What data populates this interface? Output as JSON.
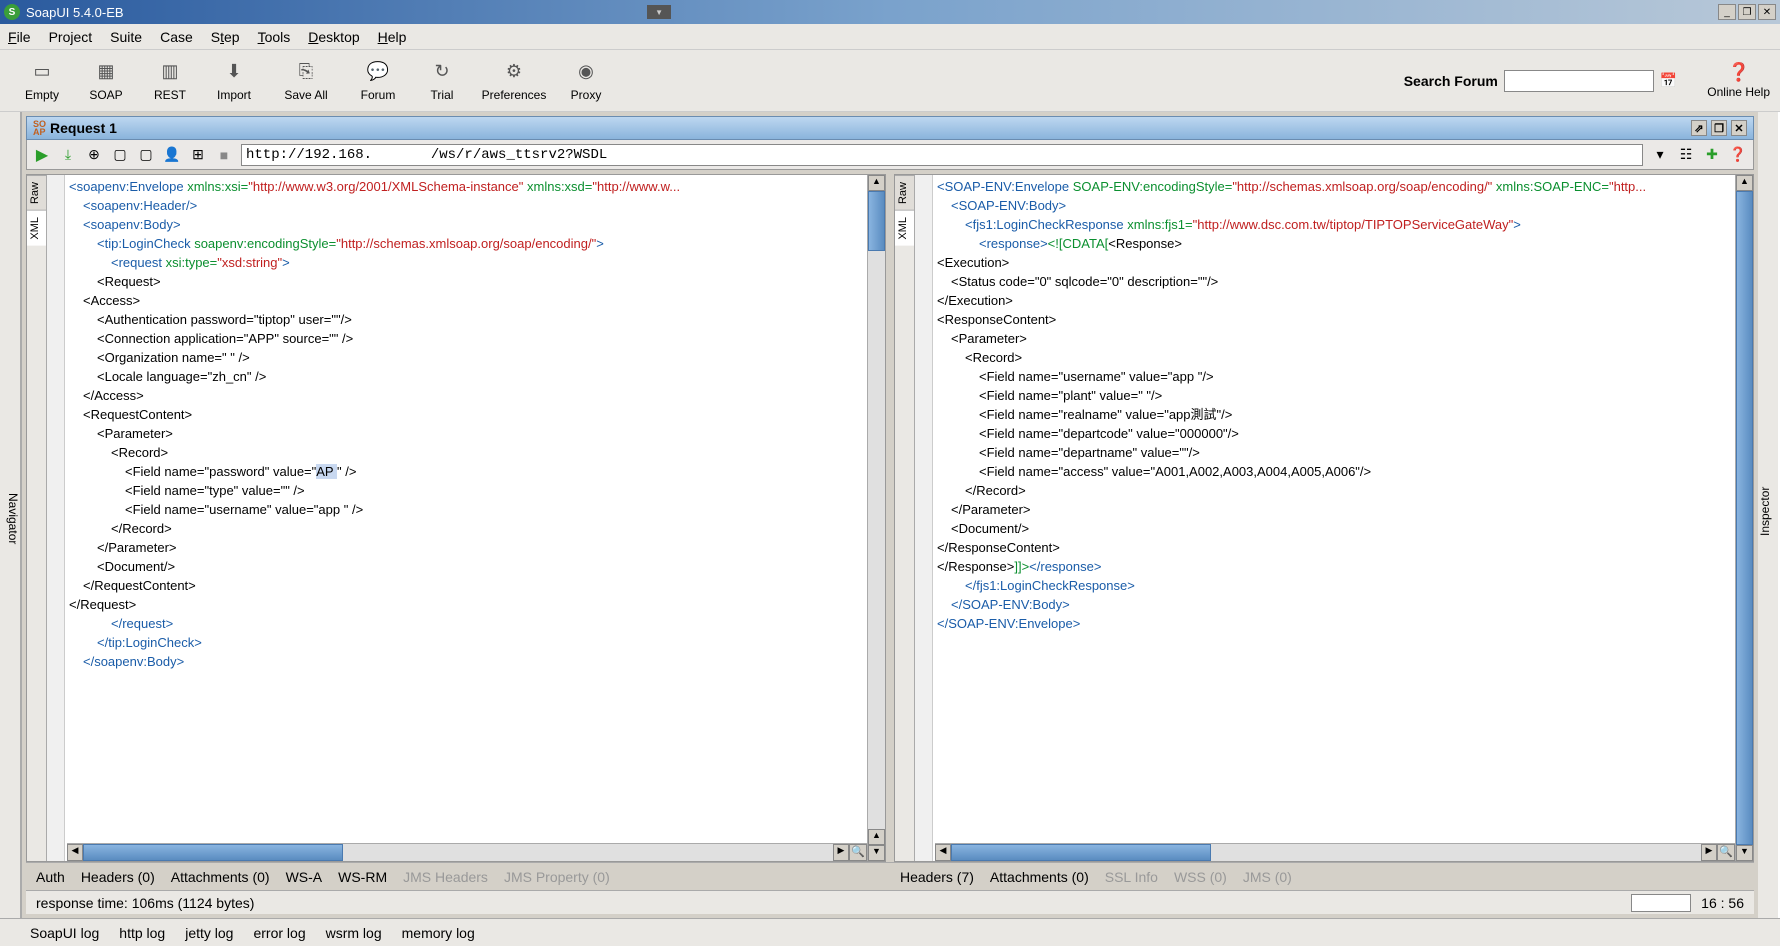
{
  "app": {
    "title": "SoapUI 5.4.0-EB"
  },
  "menubar": [
    "File",
    "Project",
    "Suite",
    "Case",
    "Step",
    "Tools",
    "Desktop",
    "Help"
  ],
  "toolbar": {
    "items": [
      "Empty",
      "SOAP",
      "REST",
      "Import",
      "Save All",
      "Forum",
      "Trial",
      "Preferences",
      "Proxy"
    ],
    "search_label": "Search Forum",
    "search_value": "",
    "online_help": "Online Help"
  },
  "sidebar_left": "Navigator",
  "sidebar_right": "Inspector",
  "request_tab": {
    "badge": "SO\nAP",
    "label": "Request 1"
  },
  "url": "http://192.168.       /ws/r/aws_ttsrv2?WSDL",
  "panel_vtabs": [
    "Raw",
    "XML"
  ],
  "request_xml": {
    "lines": [
      {
        "i": 0,
        "parts": [
          {
            "t": "tag",
            "s": "<soapenv:Envelope "
          },
          {
            "t": "attr",
            "s": "xmlns:xsi="
          },
          {
            "t": "val",
            "s": "\"http://www.w3.org/2001/XMLSchema-instance\" "
          },
          {
            "t": "attr",
            "s": "xmlns:xsd="
          },
          {
            "t": "val",
            "s": "\"http://www.w..."
          }
        ]
      },
      {
        "i": 1,
        "parts": [
          {
            "t": "tag",
            "s": "<soapenv:Header/>"
          }
        ]
      },
      {
        "i": 1,
        "parts": [
          {
            "t": "tag",
            "s": "<soapenv:Body>"
          }
        ]
      },
      {
        "i": 2,
        "parts": [
          {
            "t": "tag",
            "s": "<tip:LoginCheck "
          },
          {
            "t": "attr",
            "s": "soapenv:encodingStyle="
          },
          {
            "t": "val",
            "s": "\"http://schemas.xmlsoap.org/soap/encoding/\""
          },
          {
            "t": "tag",
            "s": ">"
          }
        ]
      },
      {
        "i": 3,
        "parts": [
          {
            "t": "tag",
            "s": "<request "
          },
          {
            "t": "attr",
            "s": "xsi:type="
          },
          {
            "t": "val",
            "s": "\"xsd:string\""
          },
          {
            "t": "tag",
            "s": ">"
          }
        ]
      },
      {
        "i": 2,
        "parts": [
          {
            "t": "text",
            "s": "&lt;Request>"
          }
        ]
      },
      {
        "i": 1,
        "parts": [
          {
            "t": "text",
            "s": "&lt;Access>"
          }
        ]
      },
      {
        "i": 2,
        "parts": [
          {
            "t": "text",
            "s": "&lt;Authentication password=\"tiptop\" user=\"\"/>"
          }
        ]
      },
      {
        "i": 2,
        "parts": [
          {
            "t": "text",
            "s": "&lt;Connection application=\"APP\" source=\"\" />"
          }
        ]
      },
      {
        "i": 2,
        "parts": [
          {
            "t": "text",
            "s": "&lt;Organization name=\"    \" />"
          }
        ]
      },
      {
        "i": 2,
        "parts": [
          {
            "t": "text",
            "s": "&lt;Locale language=\"zh_cn\" />"
          }
        ]
      },
      {
        "i": 1,
        "parts": [
          {
            "t": "text",
            "s": "&lt;/Access>"
          }
        ]
      },
      {
        "i": 1,
        "parts": [
          {
            "t": "text",
            "s": "&lt;RequestContent>"
          }
        ]
      },
      {
        "i": 2,
        "parts": [
          {
            "t": "text",
            "s": "&lt;Parameter>"
          }
        ]
      },
      {
        "i": 3,
        "parts": [
          {
            "t": "text",
            "s": "&lt;Record>"
          }
        ]
      },
      {
        "i": 4,
        "parts": [
          {
            "t": "text",
            "s": "&lt;Field name=\"password\" value=\""
          },
          {
            "t": "sel",
            "s": "AP   "
          },
          {
            "t": "caret",
            "s": " "
          },
          {
            "t": "text",
            "s": "\" />"
          }
        ]
      },
      {
        "i": 4,
        "parts": [
          {
            "t": "text",
            "s": "&lt;Field name=\"type\" value=\"\" />"
          }
        ]
      },
      {
        "i": 4,
        "parts": [
          {
            "t": "text",
            "s": "&lt;Field name=\"username\" value=\"app   \" />"
          }
        ]
      },
      {
        "i": 3,
        "parts": [
          {
            "t": "text",
            "s": "&lt;/Record>"
          }
        ]
      },
      {
        "i": 2,
        "parts": [
          {
            "t": "text",
            "s": "&lt;/Parameter>"
          }
        ]
      },
      {
        "i": 2,
        "parts": [
          {
            "t": "text",
            "s": "&lt;Document/>"
          }
        ]
      },
      {
        "i": 1,
        "parts": [
          {
            "t": "text",
            "s": "&lt;/RequestContent>"
          }
        ]
      },
      {
        "i": 0,
        "parts": [
          {
            "t": "text",
            "s": "&lt;/Request>"
          }
        ]
      },
      {
        "i": 3,
        "parts": [
          {
            "t": "tag",
            "s": "</request>"
          }
        ]
      },
      {
        "i": 2,
        "parts": [
          {
            "t": "tag",
            "s": "</tip:LoginCheck>"
          }
        ]
      },
      {
        "i": 1,
        "parts": [
          {
            "t": "tag",
            "s": "</soapenv:Body>"
          }
        ]
      }
    ]
  },
  "response_xml": {
    "lines": [
      {
        "i": 0,
        "parts": [
          {
            "t": "tag",
            "s": "<SOAP-ENV:Envelope "
          },
          {
            "t": "attr",
            "s": "SOAP-ENV:encodingStyle="
          },
          {
            "t": "val",
            "s": "\"http://schemas.xmlsoap.org/soap/encoding/\" "
          },
          {
            "t": "attr",
            "s": "xmlns:SOAP-ENC="
          },
          {
            "t": "val",
            "s": "\"http..."
          }
        ]
      },
      {
        "i": 1,
        "parts": [
          {
            "t": "tag",
            "s": "<SOAP-ENV:Body>"
          }
        ]
      },
      {
        "i": 2,
        "parts": [
          {
            "t": "tag",
            "s": "<fjs1:LoginCheckResponse "
          },
          {
            "t": "attr",
            "s": "xmlns:fjs1="
          },
          {
            "t": "val",
            "s": "\"http://www.dsc.com.tw/tiptop/TIPTOPServiceGateWay\""
          },
          {
            "t": "tag",
            "s": ">"
          }
        ]
      },
      {
        "i": 3,
        "parts": [
          {
            "t": "tag",
            "s": "<response>"
          },
          {
            "t": "cdata",
            "s": "<![CDATA["
          },
          {
            "t": "text",
            "s": "<Response>"
          }
        ]
      },
      {
        "i": 0,
        "parts": [
          {
            "t": "text",
            "s": "<Execution>"
          }
        ]
      },
      {
        "i": 1,
        "parts": [
          {
            "t": "text",
            "s": "<Status code=\"0\" sqlcode=\"0\" description=\"\"/>"
          }
        ]
      },
      {
        "i": 0,
        "parts": [
          {
            "t": "text",
            "s": "</Execution>"
          }
        ]
      },
      {
        "i": 0,
        "parts": [
          {
            "t": "text",
            "s": "<ResponseContent>"
          }
        ]
      },
      {
        "i": 1,
        "parts": [
          {
            "t": "text",
            "s": "<Parameter>"
          }
        ]
      },
      {
        "i": 2,
        "parts": [
          {
            "t": "text",
            "s": "<Record>"
          }
        ]
      },
      {
        "i": 3,
        "parts": [
          {
            "t": "text",
            "s": "<Field name=\"username\" value=\"app   \"/>"
          }
        ]
      },
      {
        "i": 3,
        "parts": [
          {
            "t": "text",
            "s": "<Field name=\"plant\" value=\"    \"/>"
          }
        ]
      },
      {
        "i": 3,
        "parts": [
          {
            "t": "text",
            "s": "<Field name=\"realname\" value=\"app測試\"/>"
          }
        ]
      },
      {
        "i": 3,
        "parts": [
          {
            "t": "text",
            "s": "<Field name=\"departcode\" value=\"000000\"/>"
          }
        ]
      },
      {
        "i": 3,
        "parts": [
          {
            "t": "text",
            "s": "<Field name=\"departname\" value=\"\"/>"
          }
        ]
      },
      {
        "i": 3,
        "parts": [
          {
            "t": "text",
            "s": "<Field name=\"access\" value=\"A001,A002,A003,A004,A005,A006\"/>"
          }
        ]
      },
      {
        "i": 2,
        "parts": [
          {
            "t": "text",
            "s": "</Record>"
          }
        ]
      },
      {
        "i": 1,
        "parts": [
          {
            "t": "text",
            "s": "</Parameter>"
          }
        ]
      },
      {
        "i": 1,
        "parts": [
          {
            "t": "text",
            "s": "<Document/>"
          }
        ]
      },
      {
        "i": 0,
        "parts": [
          {
            "t": "text",
            "s": "</ResponseContent>"
          }
        ]
      },
      {
        "i": 0,
        "parts": [
          {
            "t": "text",
            "s": "</Response>"
          },
          {
            "t": "cdata",
            "s": "]]>"
          },
          {
            "t": "tag",
            "s": "</response>"
          }
        ]
      },
      {
        "i": 2,
        "parts": [
          {
            "t": "tag",
            "s": "</fjs1:LoginCheckResponse>"
          }
        ]
      },
      {
        "i": 1,
        "parts": [
          {
            "t": "tag",
            "s": "</SOAP-ENV:Body>"
          }
        ]
      },
      {
        "i": 0,
        "parts": [
          {
            "t": "tag",
            "s": "</SOAP-ENV:Envelope>"
          }
        ]
      }
    ]
  },
  "bottom_tabs_left": [
    {
      "label": "Auth",
      "dis": false
    },
    {
      "label": "Headers (0)",
      "dis": false
    },
    {
      "label": "Attachments (0)",
      "dis": false
    },
    {
      "label": "WS-A",
      "dis": false
    },
    {
      "label": "WS-RM",
      "dis": false
    },
    {
      "label": "JMS Headers",
      "dis": true
    },
    {
      "label": "JMS Property (0)",
      "dis": true
    }
  ],
  "bottom_tabs_right": [
    {
      "label": "Headers (7)",
      "dis": false
    },
    {
      "label": "Attachments (0)",
      "dis": false
    },
    {
      "label": "SSL Info",
      "dis": true
    },
    {
      "label": "WSS (0)",
      "dis": true
    },
    {
      "label": "JMS (0)",
      "dis": true
    }
  ],
  "status": {
    "text": "response time: 106ms (1124 bytes)",
    "pos": "16 : 56"
  },
  "log_tabs": [
    "SoapUI log",
    "http log",
    "jetty log",
    "error log",
    "wsrm log",
    "memory log"
  ]
}
